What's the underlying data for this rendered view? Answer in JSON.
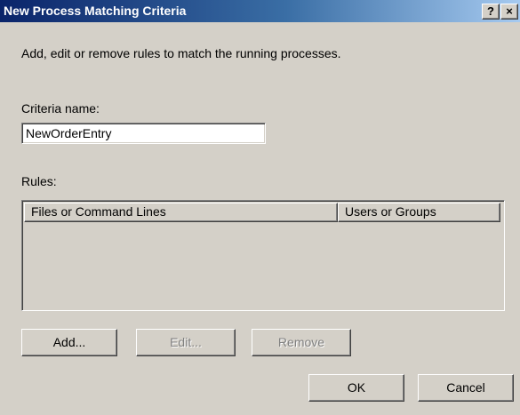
{
  "window": {
    "title": "New Process Matching Criteria",
    "help_label": "?",
    "close_label": "×"
  },
  "instructions": "Add, edit or remove rules to match the running processes.",
  "criteria": {
    "label": "Criteria name:",
    "value": "NewOrderEntry"
  },
  "rules": {
    "label": "Rules:",
    "columns": [
      "Files or Command Lines",
      "Users or Groups"
    ]
  },
  "buttons": {
    "add": "Add...",
    "edit": "Edit...",
    "remove": "Remove",
    "ok": "OK",
    "cancel": "Cancel"
  },
  "colors": {
    "titlebar_start": "#0a246a",
    "titlebar_end": "#a6caf0",
    "dialog_face": "#d4d0c8"
  }
}
